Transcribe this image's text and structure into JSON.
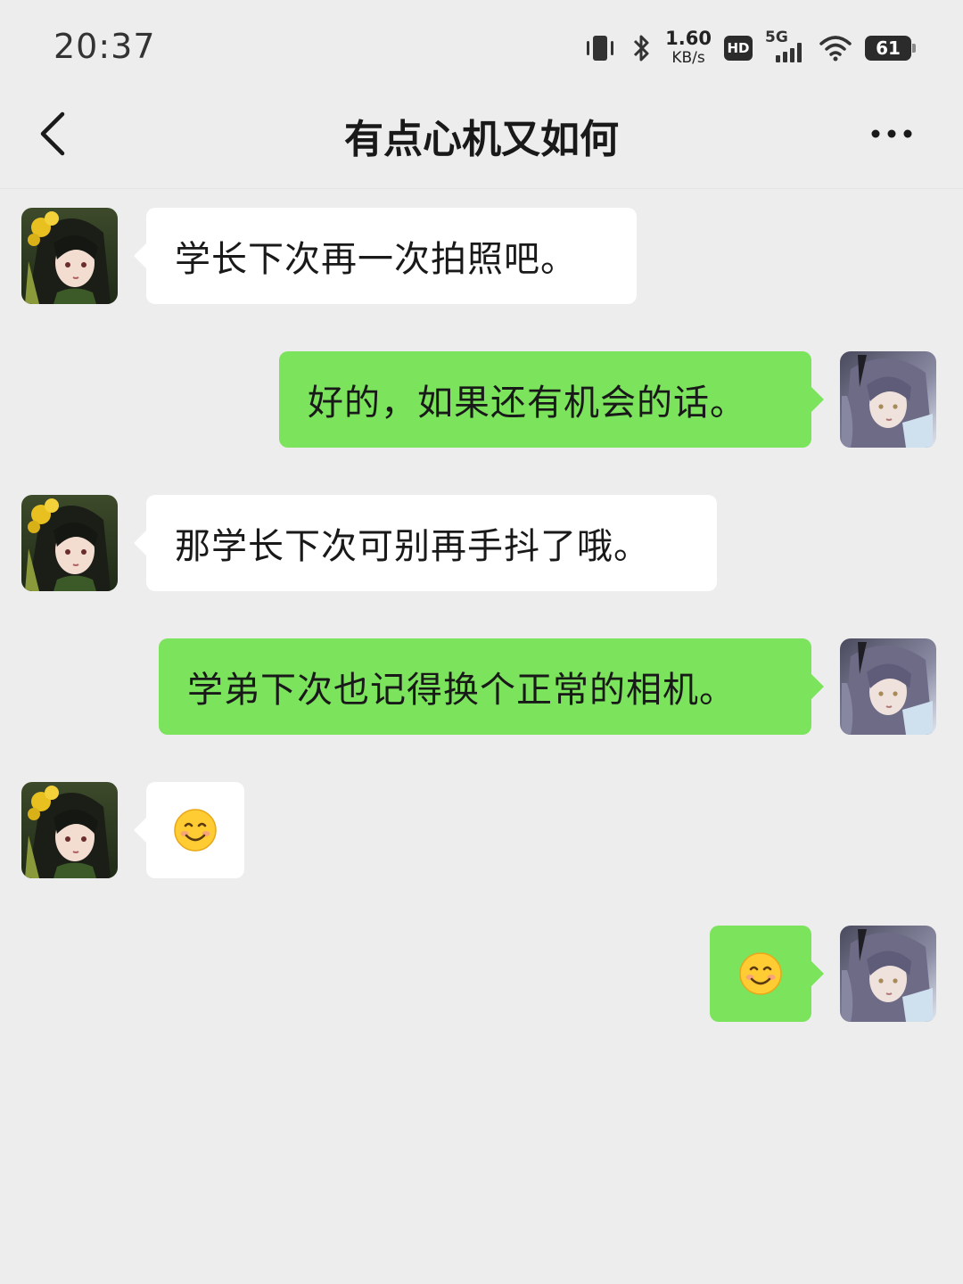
{
  "status_bar": {
    "time": "20:37",
    "net_speed_value": "1.60",
    "net_speed_unit": "KB/s",
    "hd_label": "HD",
    "network_label": "5G",
    "battery_level": "61",
    "icons": [
      "vibrate-icon",
      "bluetooth-icon",
      "hd-icon",
      "signal-icon",
      "wifi-icon",
      "battery-icon"
    ]
  },
  "nav": {
    "title": "有点心机又如何",
    "back_icon": "chevron-left-icon",
    "more_icon": "more-dots-icon"
  },
  "messages": [
    {
      "side": "left",
      "type": "text",
      "text": "学长下次再一次拍照吧。"
    },
    {
      "side": "right",
      "type": "text",
      "text": "好的，如果还有机会的话。"
    },
    {
      "side": "left",
      "type": "text",
      "text": "那学长下次可别再手抖了哦。"
    },
    {
      "side": "right",
      "type": "text",
      "text": "学弟下次也记得换个正常的相机。"
    },
    {
      "side": "left",
      "type": "emoji",
      "emoji": "smiling-face-emoji"
    },
    {
      "side": "right",
      "type": "emoji",
      "emoji": "smiling-face-emoji"
    }
  ],
  "colors": {
    "background": "#ededed",
    "incoming_bubble": "#ffffff",
    "outgoing_bubble": "#7ce35d"
  }
}
